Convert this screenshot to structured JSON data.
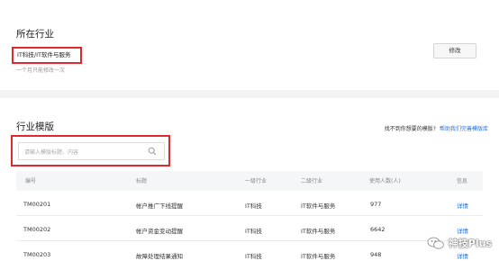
{
  "industry": {
    "title": "所在行业",
    "value": "IT科技/IT软件与服务",
    "hint": "一个月只能修改一次",
    "edit_label": "修改"
  },
  "templates": {
    "title": "行业模版",
    "help_question": "找不到你想要的模版?",
    "help_link": "帮助我们完善模版库",
    "search_placeholder": "请输入模版标题、内容",
    "columns": [
      "编号",
      "标题",
      "一级行业",
      "二级行业",
      "使用人数(人)",
      "信息"
    ],
    "rows": [
      [
        "TM00201",
        "帐户推广下线提醒",
        "IT科技",
        "IT软件与服务",
        "977",
        "详情"
      ],
      [
        "TM00202",
        "帐户资金变动提醒",
        "IT科技",
        "IT软件与服务",
        "6642",
        "详情"
      ],
      [
        "TM00203",
        "故障处理结果通知",
        "IT科技",
        "IT软件与服务",
        "948",
        "详情"
      ]
    ]
  },
  "watermark": {
    "text": "神技Plus"
  },
  "colors": {
    "highlight": "#e0282e",
    "link": "#1f6fd6"
  }
}
